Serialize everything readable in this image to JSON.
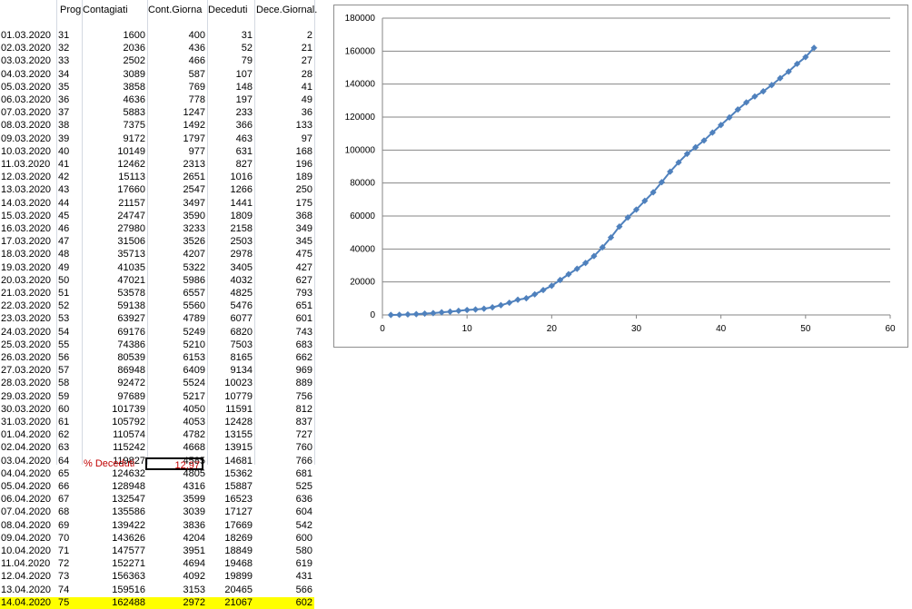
{
  "sheet": {
    "headers": [
      "Prog",
      "Contagiati",
      "Cont.Giorna",
      "Deceduti",
      "Dece.Giornal."
    ],
    "rows": [
      [
        "01.03.2020",
        "31",
        "1600",
        "400",
        "31",
        "2"
      ],
      [
        "02.03.2020",
        "32",
        "2036",
        "436",
        "52",
        "21"
      ],
      [
        "03.03.2020",
        "33",
        "2502",
        "466",
        "79",
        "27"
      ],
      [
        "04.03.2020",
        "34",
        "3089",
        "587",
        "107",
        "28"
      ],
      [
        "05.03.2020",
        "35",
        "3858",
        "769",
        "148",
        "41"
      ],
      [
        "06.03.2020",
        "36",
        "4636",
        "778",
        "197",
        "49"
      ],
      [
        "07.03.2020",
        "37",
        "5883",
        "1247",
        "233",
        "36"
      ],
      [
        "08.03.2020",
        "38",
        "7375",
        "1492",
        "366",
        "133"
      ],
      [
        "09.03.2020",
        "39",
        "9172",
        "1797",
        "463",
        "97"
      ],
      [
        "10.03.2020",
        "40",
        "10149",
        "977",
        "631",
        "168"
      ],
      [
        "11.03.2020",
        "41",
        "12462",
        "2313",
        "827",
        "196"
      ],
      [
        "12.03.2020",
        "42",
        "15113",
        "2651",
        "1016",
        "189"
      ],
      [
        "13.03.2020",
        "43",
        "17660",
        "2547",
        "1266",
        "250"
      ],
      [
        "14.03.2020",
        "44",
        "21157",
        "3497",
        "1441",
        "175"
      ],
      [
        "15.03.2020",
        "45",
        "24747",
        "3590",
        "1809",
        "368"
      ],
      [
        "16.03.2020",
        "46",
        "27980",
        "3233",
        "2158",
        "349"
      ],
      [
        "17.03.2020",
        "47",
        "31506",
        "3526",
        "2503",
        "345"
      ],
      [
        "18.03.2020",
        "48",
        "35713",
        "4207",
        "2978",
        "475"
      ],
      [
        "19.03.2020",
        "49",
        "41035",
        "5322",
        "3405",
        "427"
      ],
      [
        "20.03.2020",
        "50",
        "47021",
        "5986",
        "4032",
        "627"
      ],
      [
        "21.03.2020",
        "51",
        "53578",
        "6557",
        "4825",
        "793"
      ],
      [
        "22.03.2020",
        "52",
        "59138",
        "5560",
        "5476",
        "651"
      ],
      [
        "23.03.2020",
        "53",
        "63927",
        "4789",
        "6077",
        "601"
      ],
      [
        "24.03.2020",
        "54",
        "69176",
        "5249",
        "6820",
        "743"
      ],
      [
        "25.03.2020",
        "55",
        "74386",
        "5210",
        "7503",
        "683"
      ],
      [
        "26.03.2020",
        "56",
        "80539",
        "6153",
        "8165",
        "662"
      ],
      [
        "27.03.2020",
        "57",
        "86948",
        "6409",
        "9134",
        "969"
      ],
      [
        "28.03.2020",
        "58",
        "92472",
        "5524",
        "10023",
        "889"
      ],
      [
        "29.03.2020",
        "59",
        "97689",
        "5217",
        "10779",
        "756"
      ],
      [
        "30.03.2020",
        "60",
        "101739",
        "4050",
        "11591",
        "812"
      ],
      [
        "31.03.2020",
        "61",
        "105792",
        "4053",
        "12428",
        "837"
      ],
      [
        "01.04.2020",
        "62",
        "110574",
        "4782",
        "13155",
        "727"
      ],
      [
        "02.04.2020",
        "63",
        "115242",
        "4668",
        "13915",
        "760"
      ],
      [
        "03.04.2020",
        "64",
        "119827",
        "4585",
        "14681",
        "766"
      ],
      [
        "04.04.2020",
        "65",
        "124632",
        "4805",
        "15362",
        "681"
      ],
      [
        "05.04.2020",
        "66",
        "128948",
        "4316",
        "15887",
        "525"
      ],
      [
        "06.04.2020",
        "67",
        "132547",
        "3599",
        "16523",
        "636"
      ],
      [
        "07.04.2020",
        "68",
        "135586",
        "3039",
        "17127",
        "604"
      ],
      [
        "08.04.2020",
        "69",
        "139422",
        "3836",
        "17669",
        "542"
      ],
      [
        "09.04.2020",
        "70",
        "143626",
        "4204",
        "18269",
        "600"
      ],
      [
        "10.04.2020",
        "71",
        "147577",
        "3951",
        "18849",
        "580"
      ],
      [
        "11.04.2020",
        "72",
        "152271",
        "4694",
        "19468",
        "619"
      ],
      [
        "12.04.2020",
        "73",
        "156363",
        "4092",
        "19899",
        "431"
      ],
      [
        "13.04.2020",
        "74",
        "159516",
        "3153",
        "20465",
        "566"
      ],
      [
        "14.04.2020",
        "75",
        "162488",
        "2972",
        "21067",
        "602"
      ]
    ],
    "footer_label": "% Deceduti",
    "footer_value": "12,97",
    "highlight_color": "#ffff00"
  },
  "chart_data": {
    "type": "scatter",
    "series": [
      {
        "x": [
          1,
          2,
          3,
          4,
          5,
          6,
          7,
          8,
          9,
          10,
          11,
          12,
          13,
          14,
          15,
          16,
          17,
          18,
          19,
          20,
          21,
          22,
          23,
          24,
          25,
          26,
          27,
          28,
          29,
          30,
          31,
          32,
          33,
          34,
          35,
          36,
          37,
          38,
          39,
          40,
          41,
          42,
          43,
          44,
          45,
          46,
          47,
          48,
          49,
          50,
          51
        ],
        "values": [
          0,
          100,
          300,
          500,
          800,
          1100,
          1600,
          2000,
          2500,
          3000,
          3300,
          3800,
          4600,
          5900,
          7400,
          9200,
          10100,
          12500,
          15100,
          17700,
          21200,
          24700,
          28000,
          31500,
          35700,
          41000,
          47000,
          53600,
          59100,
          63900,
          69200,
          74400,
          80500,
          86900,
          92500,
          97700,
          101700,
          105800,
          110600,
          115200,
          119800,
          124600,
          128900,
          132500,
          135600,
          139400,
          143600,
          147600,
          152300,
          156400,
          162000
        ],
        "color": "#4f81bd"
      }
    ],
    "xlim": [
      0,
      60
    ],
    "ylim": [
      0,
      180000
    ],
    "xticks": [
      "0",
      "10",
      "20",
      "30",
      "40",
      "50",
      "60"
    ],
    "yticks": [
      "0",
      "20000",
      "40000",
      "60000",
      "80000",
      "100000",
      "120000",
      "140000",
      "160000",
      "180000"
    ],
    "grid": true
  }
}
